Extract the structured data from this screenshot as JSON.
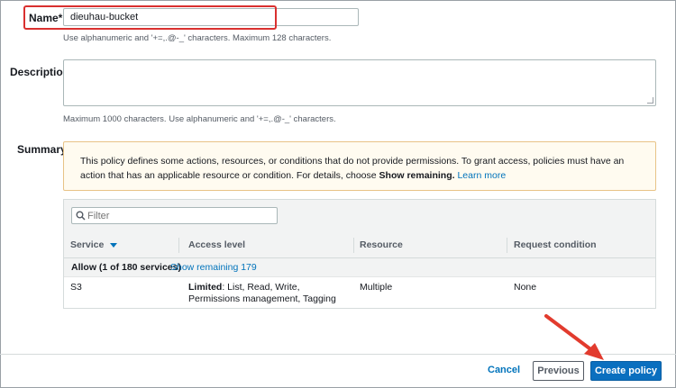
{
  "name_field": {
    "label": "Name*",
    "value": "dieuhau-bucket",
    "hint": "Use alphanumeric and '+=,.@-_' characters. Maximum 128 characters."
  },
  "description_field": {
    "label": "Description",
    "value": "",
    "hint": "Maximum 1000 characters. Use alphanumeric and '+=,.@-_' characters."
  },
  "summary": {
    "label": "Summary",
    "warning_text_1": "This policy defines some actions, resources, or conditions that do not provide permissions. To grant access, policies must have an action that has an applicable resource or condition. For details, choose ",
    "warning_bold": "Show remaining.",
    "warning_link": "Learn more",
    "filter_placeholder": "Filter",
    "columns": [
      "Service",
      "Access level",
      "Resource",
      "Request condition"
    ],
    "group_label": "Allow (1 of 180 services)",
    "group_link": "Show remaining 179",
    "rows": [
      {
        "service": "S3",
        "access_level_bold": "Limited",
        "access_level_rest": ": List, Read, Write, Permissions management, Tagging",
        "resource": "Multiple",
        "request_condition": "None"
      }
    ]
  },
  "footer": {
    "cancel": "Cancel",
    "previous": "Previous",
    "create": "Create policy"
  },
  "colors": {
    "highlight": "#d9302f",
    "primary_button": "#0a6fbf",
    "link": "#0073bb",
    "warning_bg": "#fffbf0",
    "annotation_arrow": "#e23b2e"
  }
}
